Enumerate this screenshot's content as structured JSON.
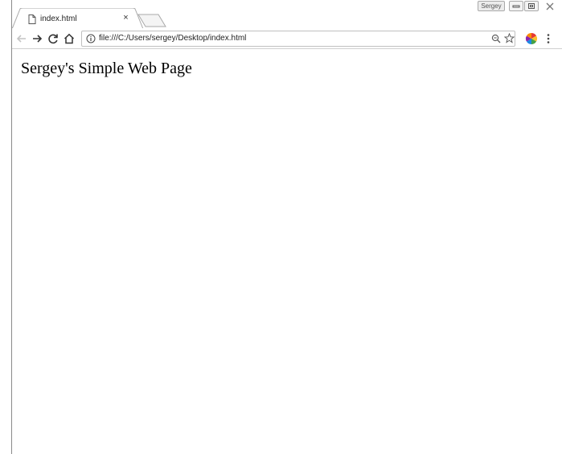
{
  "window": {
    "profile_label": "Sergey"
  },
  "tab": {
    "title": "index.html",
    "close_glyph": "×",
    "favicon": "page-icon"
  },
  "toolbar": {
    "url": "file:///C:/Users/sergey/Desktop/index.html",
    "icons": {
      "back": "arrow-left-icon",
      "forward": "arrow-right-icon",
      "reload": "reload-icon",
      "home": "home-icon",
      "info": "info-icon",
      "zoom": "zoom-icon",
      "star": "star-icon",
      "extension": "extension-icon",
      "menu": "more-vertical-icon"
    }
  },
  "page": {
    "heading": "Sergey's Simple Web Page"
  },
  "colors": {
    "tab_border": "#a9a9a9",
    "frame_border": "#8a8a8a",
    "text": "#000000"
  }
}
